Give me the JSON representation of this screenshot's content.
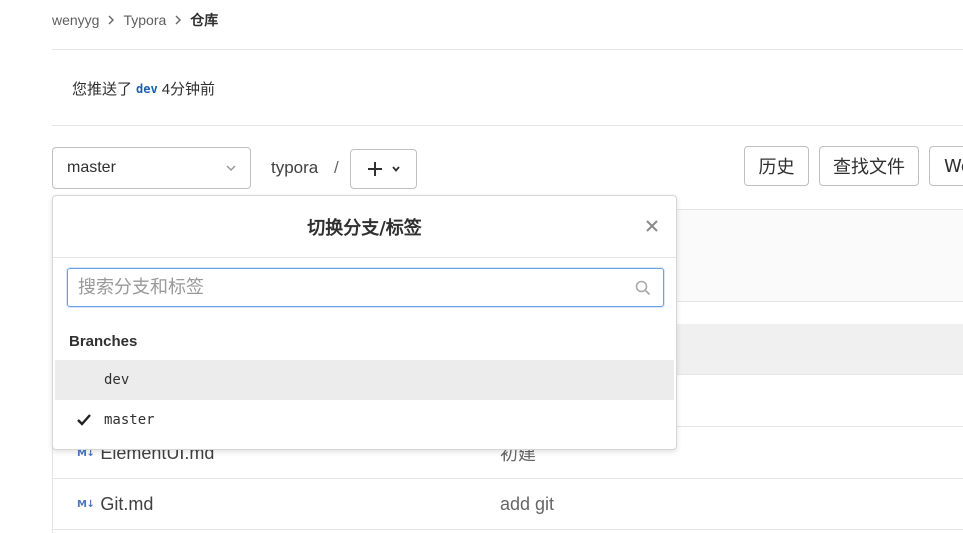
{
  "breadcrumb": {
    "user": "wenyyg",
    "project": "Typora",
    "current": "仓库"
  },
  "push_notice": {
    "prefix": "您推送了",
    "branch": "dev",
    "suffix": "4分钟前"
  },
  "toolbar": {
    "branch_selected": "master",
    "path_root": "typora",
    "path_sep": "/",
    "history_label": "历史",
    "find_file_label": "查找文件",
    "web_label": "We"
  },
  "dropdown": {
    "title": "切换分支/标签",
    "search_placeholder": "搜索分支和标签",
    "section_label": "Branches",
    "branches": [
      {
        "name": "dev",
        "selected": false
      },
      {
        "name": "master",
        "selected": true
      }
    ]
  },
  "files": [
    {
      "name": "ElementUI.md",
      "message": "初建",
      "icon": "markdown-icon"
    },
    {
      "name": "Git.md",
      "message": "add git",
      "icon": "markdown-icon"
    }
  ],
  "colors": {
    "accent": "#1f5fa8",
    "focus_border": "#6aa0e2",
    "md_icon": "#4a78c2"
  }
}
